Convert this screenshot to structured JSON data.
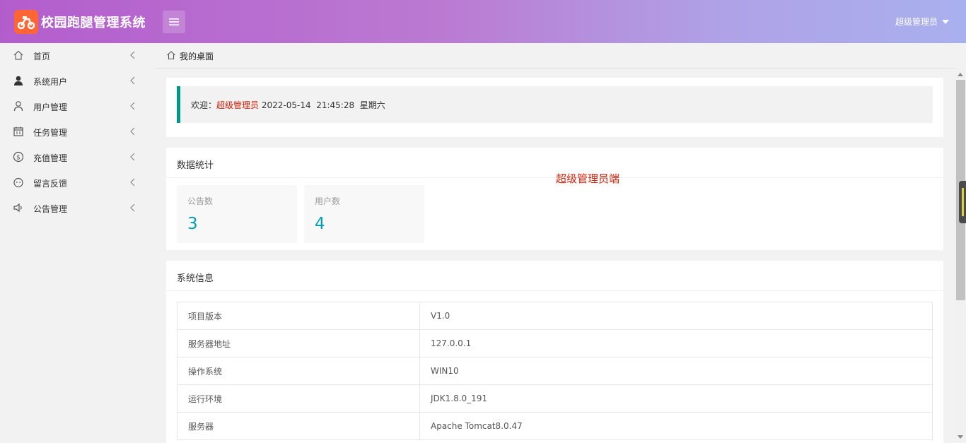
{
  "header": {
    "app_title": "校园跑腿管理系统",
    "logo_icon": "delivery-scooter-icon",
    "menu_toggle_icon": "hamburger-icon",
    "user_name": "超级管理员",
    "brand_gradient": [
      "#b35dcc",
      "#a9b0ee"
    ]
  },
  "sidebar": {
    "items": [
      {
        "label": "首页",
        "icon": "home-icon"
      },
      {
        "label": "系统用户",
        "icon": "user-filled-icon"
      },
      {
        "label": "用户管理",
        "icon": "user-outline-icon"
      },
      {
        "label": "任务管理",
        "icon": "calendar-icon"
      },
      {
        "label": "充值管理",
        "icon": "dollar-circle-icon"
      },
      {
        "label": "留言反馈",
        "icon": "smile-icon"
      },
      {
        "label": "公告管理",
        "icon": "speaker-icon"
      }
    ]
  },
  "breadcrumb": {
    "label": "我的桌面",
    "icon": "home-icon"
  },
  "welcome": {
    "prefix": "欢迎：",
    "user": "超级管理员",
    "datetime": "2022-05-14  21:45:28  星期六"
  },
  "stats": {
    "title": "数据统计",
    "annotation": "超级管理员端",
    "items": [
      {
        "label": "公告数",
        "value": "3"
      },
      {
        "label": "用户数",
        "value": "4"
      }
    ]
  },
  "sysinfo": {
    "title": "系统信息",
    "rows": [
      {
        "key": "项目版本",
        "value": "V1.0"
      },
      {
        "key": "服务器地址",
        "value": "127.0.0.1"
      },
      {
        "key": "操作系统",
        "value": "WIN10"
      },
      {
        "key": "运行环境",
        "value": "JDK1.8.0_191"
      },
      {
        "key": "服务器",
        "value": "Apache Tomcat8.0.47"
      }
    ]
  },
  "colors": {
    "accent": "#009688",
    "stat_value": "#009fb4",
    "highlight_red": "#d81e06"
  }
}
